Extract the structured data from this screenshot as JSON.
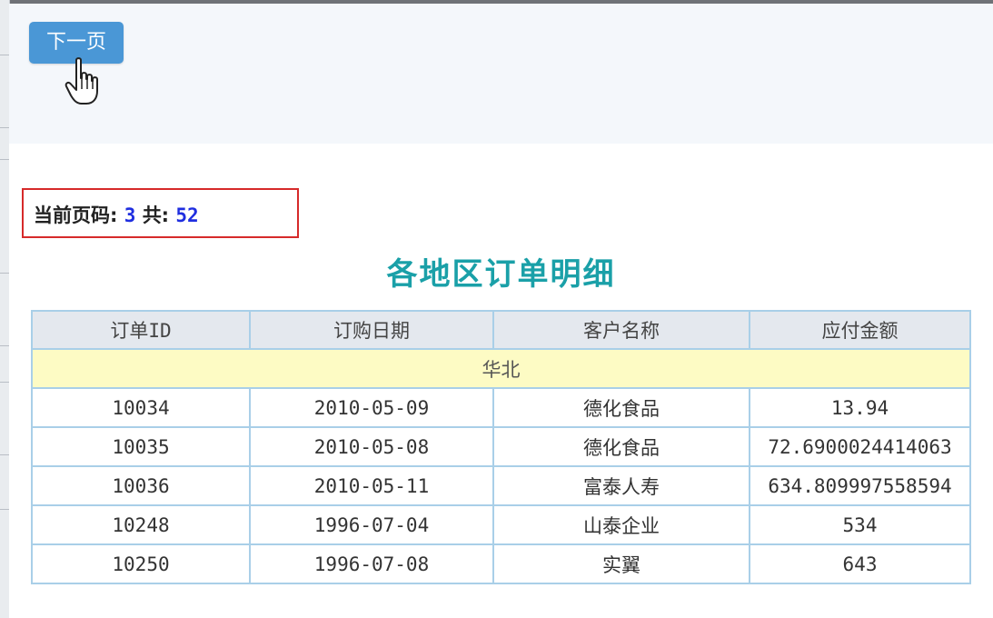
{
  "toolbar": {
    "next_page_label": "下一页"
  },
  "pagination": {
    "current_label": "当前页码:",
    "current_page": "3",
    "total_label": "共:",
    "total_pages": "52"
  },
  "report": {
    "title": "各地区订单明细",
    "columns": [
      "订单ID",
      "订购日期",
      "客户名称",
      "应付金额"
    ],
    "group_label": "华北",
    "rows": [
      [
        "10034",
        "2010-05-09",
        "德化食品",
        "13.94"
      ],
      [
        "10035",
        "2010-05-08",
        "德化食品",
        "72.6900024414063"
      ],
      [
        "10036",
        "2010-05-11",
        "富泰人寿",
        "634.809997558594"
      ],
      [
        "10248",
        "1996-07-04",
        "山泰企业",
        "534"
      ],
      [
        "10250",
        "1996-07-08",
        "实翼",
        "643"
      ]
    ]
  },
  "colors": {
    "button": "#4a97d6",
    "title": "#1aa0a8",
    "highlight_border": "#d62a2a",
    "page_number": "#1f2ee0",
    "group_row": "#fdfbc4",
    "table_border": "#a9cfe8"
  },
  "icons": {
    "cursor": "hand-pointer-icon"
  }
}
